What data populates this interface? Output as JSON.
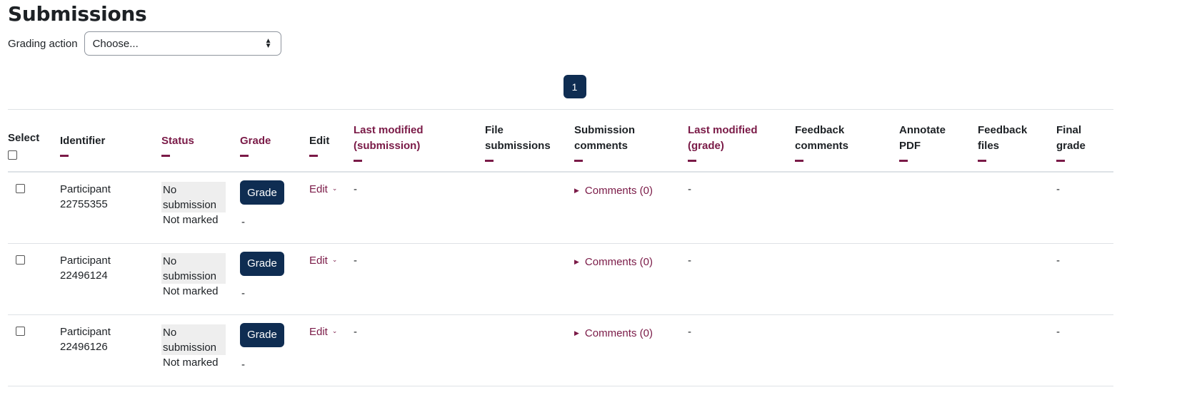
{
  "page": {
    "title": "Submissions",
    "grading_action": {
      "label": "Grading action",
      "selected": "Choose..."
    },
    "pagination": {
      "current_page": "1"
    }
  },
  "table": {
    "columns": [
      {
        "key": "select",
        "label": "Select",
        "sortable": false
      },
      {
        "key": "identifier",
        "label": "Identifier",
        "sortable": false
      },
      {
        "key": "status",
        "label": "Status",
        "sortable": true
      },
      {
        "key": "grade",
        "label": "Grade",
        "sortable": true
      },
      {
        "key": "edit",
        "label": "Edit",
        "sortable": false
      },
      {
        "key": "last_modified_submission",
        "label": "Last modified (submission)",
        "sortable": true
      },
      {
        "key": "file_submissions",
        "label": "File submissions",
        "sortable": false
      },
      {
        "key": "submission_comments",
        "label": "Submission comments",
        "sortable": false
      },
      {
        "key": "last_modified_grade",
        "label": "Last modified (grade)",
        "sortable": true
      },
      {
        "key": "feedback_comments",
        "label": "Feedback comments",
        "sortable": false
      },
      {
        "key": "annotate_pdf",
        "label": "Annotate PDF",
        "sortable": false
      },
      {
        "key": "feedback_files",
        "label": "Feedback files",
        "sortable": false
      },
      {
        "key": "final_grade",
        "label": "Final grade",
        "sortable": false
      }
    ],
    "rows": [
      {
        "identifier_line1": "Participant",
        "identifier_line2": "22755355",
        "status_line1": "No",
        "status_line2": "submission",
        "grading_status": "Not marked",
        "grade_button": "Grade",
        "grade_value": "-",
        "edit_label": "Edit",
        "last_modified_submission": "-",
        "comments_label": "Comments (0)",
        "last_modified_grade": "-",
        "final_grade": "-"
      },
      {
        "identifier_line1": "Participant",
        "identifier_line2": "22496124",
        "status_line1": "No",
        "status_line2": "submission",
        "grading_status": "Not marked",
        "grade_button": "Grade",
        "grade_value": "-",
        "edit_label": "Edit",
        "last_modified_submission": "-",
        "comments_label": "Comments (0)",
        "last_modified_grade": "-",
        "final_grade": "-"
      },
      {
        "identifier_line1": "Participant",
        "identifier_line2": "22496126",
        "status_line1": "No",
        "status_line2": "submission",
        "grading_status": "Not marked",
        "grade_button": "Grade",
        "grade_value": "-",
        "edit_label": "Edit",
        "last_modified_submission": "-",
        "comments_label": "Comments (0)",
        "last_modified_grade": "-",
        "final_grade": "-"
      }
    ]
  },
  "icons": {
    "select_arrows": "sort-arrows-icon",
    "edit_dropdown": "chevron-down-icon",
    "comments_toggle": "caret-right-icon",
    "column_collapse": "minus-icon"
  },
  "colors": {
    "primary": "#0f2d52",
    "link": "#7a1a47",
    "status_bg": "#eeeeee",
    "border": "#dee2e6"
  }
}
